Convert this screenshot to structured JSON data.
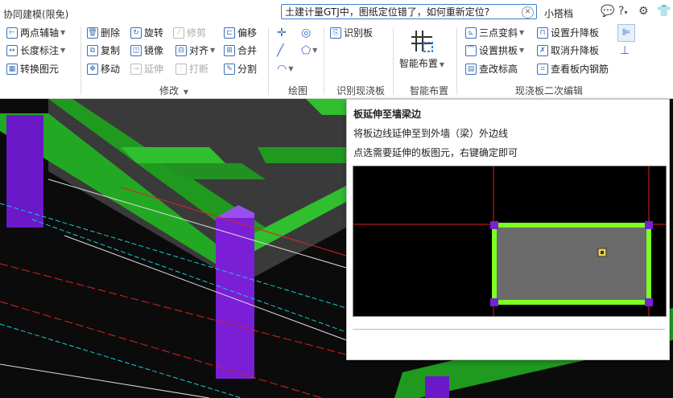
{
  "app": {
    "label": "协同建模(限免)"
  },
  "search": {
    "value": "土建计量GTJ中，图纸定位错了，如何重新定位?"
  },
  "assistant": {
    "label": "小搭档"
  },
  "top_icons": {
    "chat": "chat-bubble-icon",
    "help": "help-icon",
    "settings": "gear-icon",
    "skin": "tshirt-icon"
  },
  "ribbon": {
    "aux": {
      "two_point_axis": "两点辅轴",
      "length_dim": "长度标注",
      "convert": "转换图元"
    },
    "modify": {
      "delete": "删除",
      "rotate": "旋转",
      "trim": "修剪",
      "offset": "偏移",
      "copy": "复制",
      "mirror": "镜像",
      "align": "对齐",
      "merge": "合并",
      "move": "移动",
      "extend": "延伸",
      "break": "打断",
      "split": "分割",
      "label": "修改"
    },
    "draw": {
      "label": "绘图"
    },
    "identify": {
      "identify_slab": "识别板",
      "label": "识别现浇板"
    },
    "smart": {
      "smart_layout": "智能布置",
      "label": "智能布置"
    },
    "secondary": {
      "three_point_slope": "三点变斜",
      "set_raise": "设置升降板",
      "set_arch": "设置拱板",
      "cancel_raise": "取消升降板",
      "edit_elevation": "查改标高",
      "view_rebar": "查看板内钢筋",
      "label": "现浇板二次编辑"
    }
  },
  "tooltip": {
    "title": "板延伸至墙梁边",
    "line1": "将板边线延伸至到外墙（梁）外边线",
    "line2": "点选需要延伸的板图元，右键确定即可"
  },
  "colors": {
    "accent": "#3a7bd5",
    "beam": "#2fbf2f",
    "column": "#7a1fd6",
    "slab": "#6b6b6b",
    "arrow": "#e03030"
  }
}
